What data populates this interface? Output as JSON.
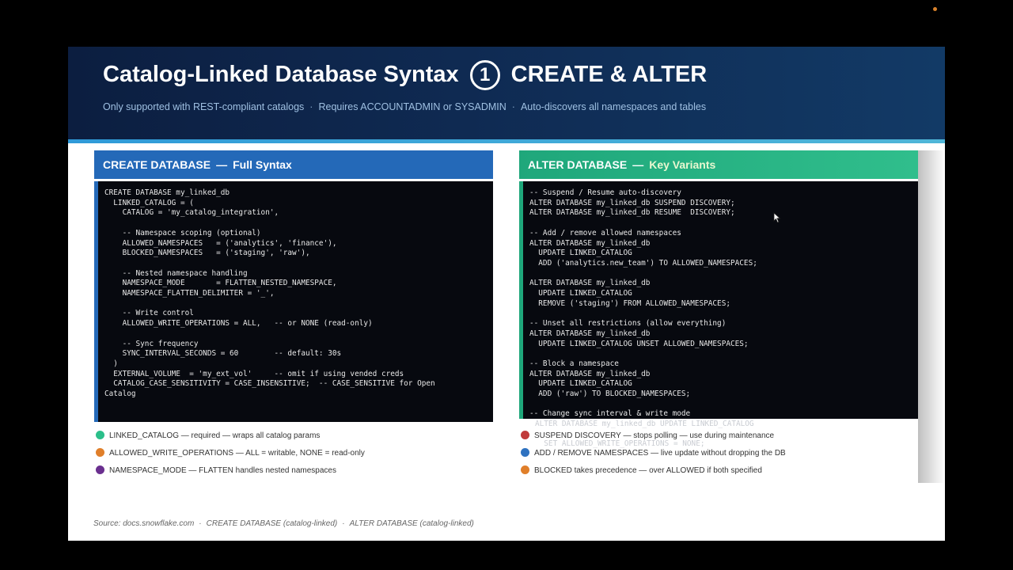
{
  "header": {
    "title_left": "Catalog-Linked Database Syntax",
    "title_number": "1",
    "title_right": "CREATE & ALTER",
    "subtitle_items": [
      "Only supported with REST-compliant catalogs",
      "Requires ACCOUNTADMIN or SYSADMIN",
      "Auto-discovers all namespaces and tables"
    ],
    "subtitle_separator": "·"
  },
  "left_panel": {
    "title": "CREATE DATABASE",
    "dash": "—",
    "subtitle": "Full Syntax",
    "code_lines": [
      "CREATE DATABASE my_linked_db",
      "  LINKED_CATALOG = (",
      "    CATALOG = 'my_catalog_integration',",
      "",
      "    -- Namespace scoping (optional)",
      "    ALLOWED_NAMESPACES   = ('analytics', 'finance'),",
      "    BLOCKED_NAMESPACES   = ('staging', 'raw'),",
      "",
      "    -- Nested namespace handling",
      "    NAMESPACE_MODE       = FLATTEN_NESTED_NAMESPACE,",
      "    NAMESPACE_FLATTEN_DELIMITER = '_',",
      "",
      "    -- Write control",
      "    ALLOWED_WRITE_OPERATIONS = ALL,   -- or NONE (read-only)",
      "",
      "    -- Sync frequency",
      "    SYNC_INTERVAL_SECONDS = 60        -- default: 30s",
      "  )",
      "  EXTERNAL_VOLUME  = 'my_ext_vol'     -- omit if using vended creds",
      "  CATALOG_CASE_SENSITIVITY = CASE_INSENSITIVE;  -- CASE_SENSITIVE for Open",
      "Catalog"
    ],
    "legend": [
      {
        "color": "#2bbf8a",
        "text": "LINKED_CATALOG  —  required — wraps all catalog params"
      },
      {
        "color": "#e07f2a",
        "text": "ALLOWED_WRITE_OPERATIONS  —  ALL = writable, NONE = read-only"
      },
      {
        "color": "#6a2f8f",
        "text": "NAMESPACE_MODE  —  FLATTEN handles nested namespaces"
      }
    ]
  },
  "right_panel": {
    "title": "ALTER DATABASE",
    "dash": "—",
    "subtitle": "Key Variants",
    "code_lines": [
      "-- Suspend / Resume auto-discovery",
      "ALTER DATABASE my_linked_db SUSPEND DISCOVERY;",
      "ALTER DATABASE my_linked_db RESUME  DISCOVERY;",
      "",
      "-- Add / remove allowed namespaces",
      "ALTER DATABASE my_linked_db",
      "  UPDATE LINKED_CATALOG",
      "  ADD ('analytics.new_team') TO ALLOWED_NAMESPACES;",
      "",
      "ALTER DATABASE my_linked_db",
      "  UPDATE LINKED_CATALOG",
      "  REMOVE ('staging') FROM ALLOWED_NAMESPACES;",
      "",
      "-- Unset all restrictions (allow everything)",
      "ALTER DATABASE my_linked_db",
      "  UPDATE LINKED_CATALOG UNSET ALLOWED_NAMESPACES;",
      "",
      "-- Block a namespace",
      "ALTER DATABASE my_linked_db",
      "  UPDATE LINKED_CATALOG",
      "  ADD ('raw') TO BLOCKED_NAMESPACES;",
      "",
      "-- Change sync interval & write mode"
    ],
    "overflow_lines": [
      "ALTER DATABASE my_linked_db UPDATE LINKED_CATALOG",
      "  SET ALLOWED_WRITE_OPERATIONS = NONE;"
    ],
    "legend": [
      {
        "color": "#c03a3a",
        "text": "SUSPEND DISCOVERY  —  stops polling — use during maintenance"
      },
      {
        "color": "#2f72c0",
        "text": "ADD / REMOVE NAMESPACES  —  live update without dropping the DB"
      },
      {
        "color": "#e07f2a",
        "text": "BLOCKED takes precedence  —  over ALLOWED if both specified"
      }
    ]
  },
  "footer": {
    "source_items": [
      "Source: docs.snowflake.com",
      "CREATE DATABASE (catalog-linked)",
      "ALTER DATABASE (catalog-linked)"
    ],
    "separator": "·"
  }
}
